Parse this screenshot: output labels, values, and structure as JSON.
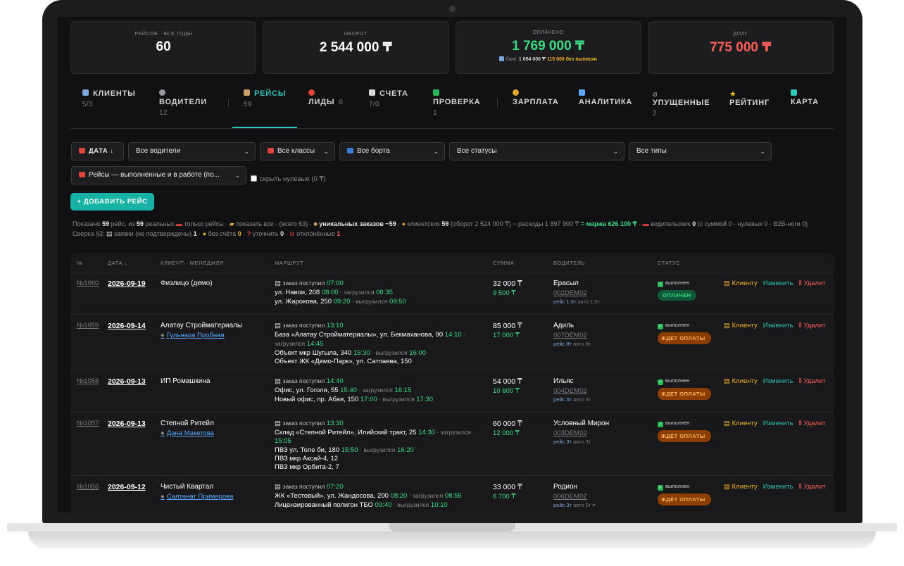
{
  "stats": [
    {
      "label": "рейсов · все годы",
      "value": "60",
      "color": "#ffffff"
    },
    {
      "label": "оборот",
      "value": "2 544 000 ₸",
      "color": "#ffffff"
    },
    {
      "label": "оплачено",
      "value": "1 769 000 ₸",
      "color": "#3ddc84",
      "sub_prefix": "банк:",
      "sub_bank": "1 654 000 ₸",
      "sub_nobill": "115 000 без выписки"
    },
    {
      "label": "долг",
      "value": "775 000 ₸",
      "color": "#ff5f57"
    }
  ],
  "tabs": [
    {
      "label": "КЛИЕНТЫ",
      "count": "5/3",
      "icon": "building-icon"
    },
    {
      "label": "ВОДИТЕЛИ",
      "count": "12",
      "icon": "person-icon"
    },
    {
      "label": "РЕЙСЫ",
      "count": "59",
      "icon": "clipboard-icon",
      "active": true
    },
    {
      "label": "ЛИДЫ",
      "count": "6",
      "icon": "target-icon"
    },
    {
      "label": "СЧЕТА",
      "count": "7/0",
      "icon": "document-icon"
    },
    {
      "label": "ПРОВЕРКА",
      "count": "1",
      "icon": "check-icon"
    },
    {
      "label": "ЗАРПЛАТА",
      "count": "",
      "icon": "money-bag-icon"
    },
    {
      "label": "АНАЛИТИКА",
      "count": "",
      "icon": "chart-icon"
    },
    {
      "label": "УПУЩЕННЫЕ",
      "count": "2",
      "icon": "slash-icon"
    },
    {
      "label": "РЕЙТИНГ",
      "count": "",
      "icon": "star-icon"
    },
    {
      "label": "КАРТА",
      "count": "",
      "icon": "map-icon"
    }
  ],
  "filters": {
    "date_sort": "ДАТА ↓",
    "drivers": "Все водители",
    "classes": "Все классы",
    "boards": "Все борта",
    "statuses": "Все статусы",
    "types": "Все типы",
    "trips": "Рейсы — выполненные и в работе (по...",
    "hide_zero": "скрыть нулевые (0 ₸)"
  },
  "add_button": "+ ДОБАВИТЬ РЕЙС",
  "summary": {
    "shown": "Показано",
    "shown_n": "59",
    "of": "рейс. из",
    "real_n": "59",
    "real": "реальных",
    "only_trips": "только рейсы ·",
    "show_all": "показать все",
    "total": "· (всего 63) ·",
    "unique": "уникальных заказов ~59",
    "clients_label": "клиентских",
    "clients_n": "59",
    "turnover": "(оборот 2 524 000 ₸) − расходы 1 897 900 ₸",
    "margin": "= маржа 626 100 ₸",
    "drivers_label": "водительских",
    "drivers_n": "0",
    "with_sum": "(с суммой 0 ·",
    "zero_b2b": "нулевых 0 · B2B-ноги 0)",
    "reconcile_label": "Сверка §3:",
    "requests": "заявки (не подтверждены)",
    "requests_n": "1",
    "no_invoice": "без счёта",
    "no_invoice_n": "0",
    "clarify": "уточнить",
    "clarify_n": "0",
    "rejected": "отклонённые",
    "rejected_n": "1"
  },
  "table": {
    "headers": {
      "num": "№",
      "date": "ДАТА",
      "date_arrow": "↓",
      "client": "КЛИЕНТ · МЕНЕДЖЕР",
      "route": "МАРШРУТ",
      "sum": "СУММА",
      "driver": "ВОДИТЕЛЬ",
      "status": "СТАТУС"
    },
    "actions": {
      "client": "Клиенту",
      "edit": "Изменить",
      "delete": "Удалит"
    },
    "rows": [
      {
        "num": "№1060",
        "date": "2026-09-19",
        "client": "Физлицо (демо)",
        "manager": "",
        "order_label": "заказ поступил",
        "order_time": "07:00",
        "stops": [
          {
            "addr": "ул. Навои, 208",
            "time": "08:00",
            "act": "· загрузился",
            "act_time": "08:35"
          },
          {
            "addr": "ул. Жарокова, 250",
            "time": "09:20",
            "act": "· выгрузился",
            "act_time": "09:50"
          }
        ],
        "sum": "32 000 ₸",
        "fee": "9 500 ₸",
        "driver": "Ерасыл",
        "plate": "002DEM02",
        "trip": "рейс 1.5т",
        "auto": "авто 1.5т",
        "status": "выполнен",
        "pay": "ОПЛАЧЕН",
        "pay_type": "paid"
      },
      {
        "num": "№1059",
        "date": "2026-09-14",
        "client": "Алатау Стройматериалы",
        "manager": "Гульнара Пробная",
        "order_label": "заказ поступил",
        "order_time": "13:10",
        "stops": [
          {
            "addr": "База «Алатау Стройматериалы», ул. Бекмаханова, 90",
            "time": "14:10",
            "act": "· загрузился",
            "act_time": "14:45"
          },
          {
            "addr": "Объект мкр Шугыла, 340",
            "time": "15:30",
            "act": "· выгрузился",
            "act_time": "16:00"
          },
          {
            "addr": "Объект ЖК «Демо-Парк», ул. Сатпаева, 150",
            "time": "",
            "act": "",
            "act_time": ""
          }
        ],
        "sum": "85 000 ₸",
        "fee": "17 000 ₸",
        "driver": "Адиль",
        "plate": "007DEM02",
        "trip": "рейс 8т",
        "auto": "авто 8т",
        "status": "выполнен",
        "pay": "ЖДЁТ ОПЛАТЫ",
        "pay_type": "wait"
      },
      {
        "num": "№1058",
        "date": "2026-09-13",
        "client": "ИП Ромашкина",
        "manager": "",
        "order_label": "заказ поступил",
        "order_time": "14:40",
        "stops": [
          {
            "addr": "Офис, ул. Гоголя, 55",
            "time": "15:40",
            "act": "· загрузился",
            "act_time": "16:15"
          },
          {
            "addr": "Новый офис, пр. Абая, 150",
            "time": "17:00",
            "act": "· выгрузился",
            "act_time": "17:30"
          }
        ],
        "sum": "54 000 ₸",
        "fee": "10 600 ₸",
        "driver": "Ильяс",
        "plate": "004DEM02",
        "trip": "рейс 3т",
        "auto": "авто 3т",
        "status": "выполнен",
        "pay": "ЖДЁТ ОПЛАТЫ",
        "pay_type": "wait"
      },
      {
        "num": "№1057",
        "date": "2026-09-13",
        "client": "Степной Ритейл",
        "manager": "Дана Макетова",
        "order_label": "заказ поступил",
        "order_time": "13:30",
        "stops": [
          {
            "addr": "Склад «Степной Ритейл», Илийский тракт, 25",
            "time": "14:30",
            "act": "· загрузился",
            "act_time": "15:05"
          },
          {
            "addr": "ПВЗ ул. Толе би, 180",
            "time": "15:50",
            "act": "· выгрузился",
            "act_time": "16:20"
          },
          {
            "addr": "ПВЗ мкр Аксай-4, 12",
            "time": "",
            "act": "",
            "act_time": ""
          },
          {
            "addr": "ПВЗ мкр Орбита-2, 7",
            "time": "",
            "act": "",
            "act_time": ""
          }
        ],
        "sum": "60 000 ₸",
        "fee": "12 000 ₸",
        "driver": "Условный Мирон",
        "plate": "003DEM02",
        "trip": "рейс 3т",
        "auto": "авто 3т",
        "status": "выполнен",
        "pay": "ЖДЁТ ОПЛАТЫ",
        "pay_type": "wait"
      },
      {
        "num": "№1056",
        "date": "2026-09-12",
        "client": "Чистый Квартал",
        "manager": "Салтанат Примерова",
        "order_label": "заказ поступил",
        "order_time": "07:20",
        "stops": [
          {
            "addr": "ЖК «Тестовый», ул. Жандосова, 200",
            "time": "08:20",
            "act": "· загрузился",
            "act_time": "08:55"
          },
          {
            "addr": "Лицензированный полигон ТБО",
            "time": "09:40",
            "act": "· выгрузился",
            "act_time": "10:10"
          }
        ],
        "sum": "33 000 ₸",
        "fee": "6 700 ₸",
        "driver": "Родион",
        "plate": "006DEM02",
        "trip": "рейс 3т",
        "auto": "авто 5т ≠",
        "status": "выполнен",
        "pay": "ЖДЁТ ОПЛАТЫ",
        "pay_type": "wait"
      }
    ]
  },
  "colors": {
    "accent": "#2ec4b6",
    "green": "#3ddc84",
    "red": "#ff5f57",
    "amber": "#f0b429"
  }
}
